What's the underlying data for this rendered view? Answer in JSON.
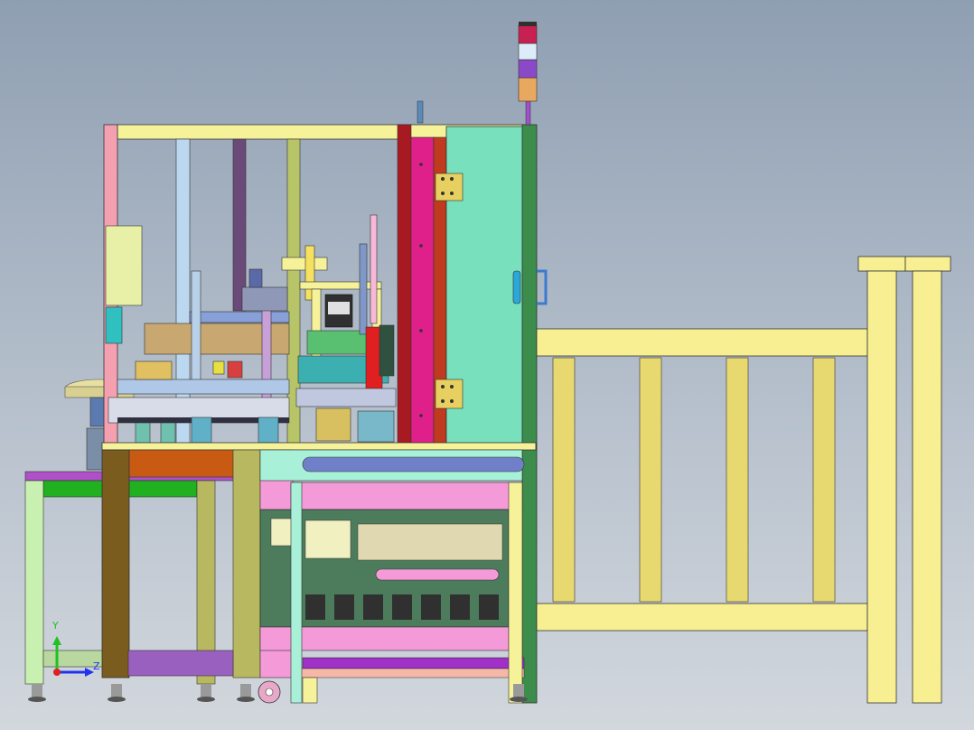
{
  "scene": {
    "axes": {
      "y_label": "Y",
      "z_label": "Z",
      "y_color": "#22c022",
      "z_color": "#2233ee",
      "origin_color": "#e02020"
    },
    "colors": {
      "frame_yellow": "#f6f29a",
      "panel_mint": "#78e0bc",
      "panel_green": "#3c8c4c",
      "magenta": "#e0208a",
      "dark_red": "#a81a22",
      "olive": "#7a5c1e",
      "light_blue": "#bcd8f0",
      "pink": "#f59ad8",
      "violet": "#8a4ac8",
      "khaki": "#b8b860",
      "orange_brown": "#c85a14",
      "green": "#20b020",
      "cabinet_green": "#4c7c5c",
      "guard_yellow": "#f7ef92"
    }
  }
}
